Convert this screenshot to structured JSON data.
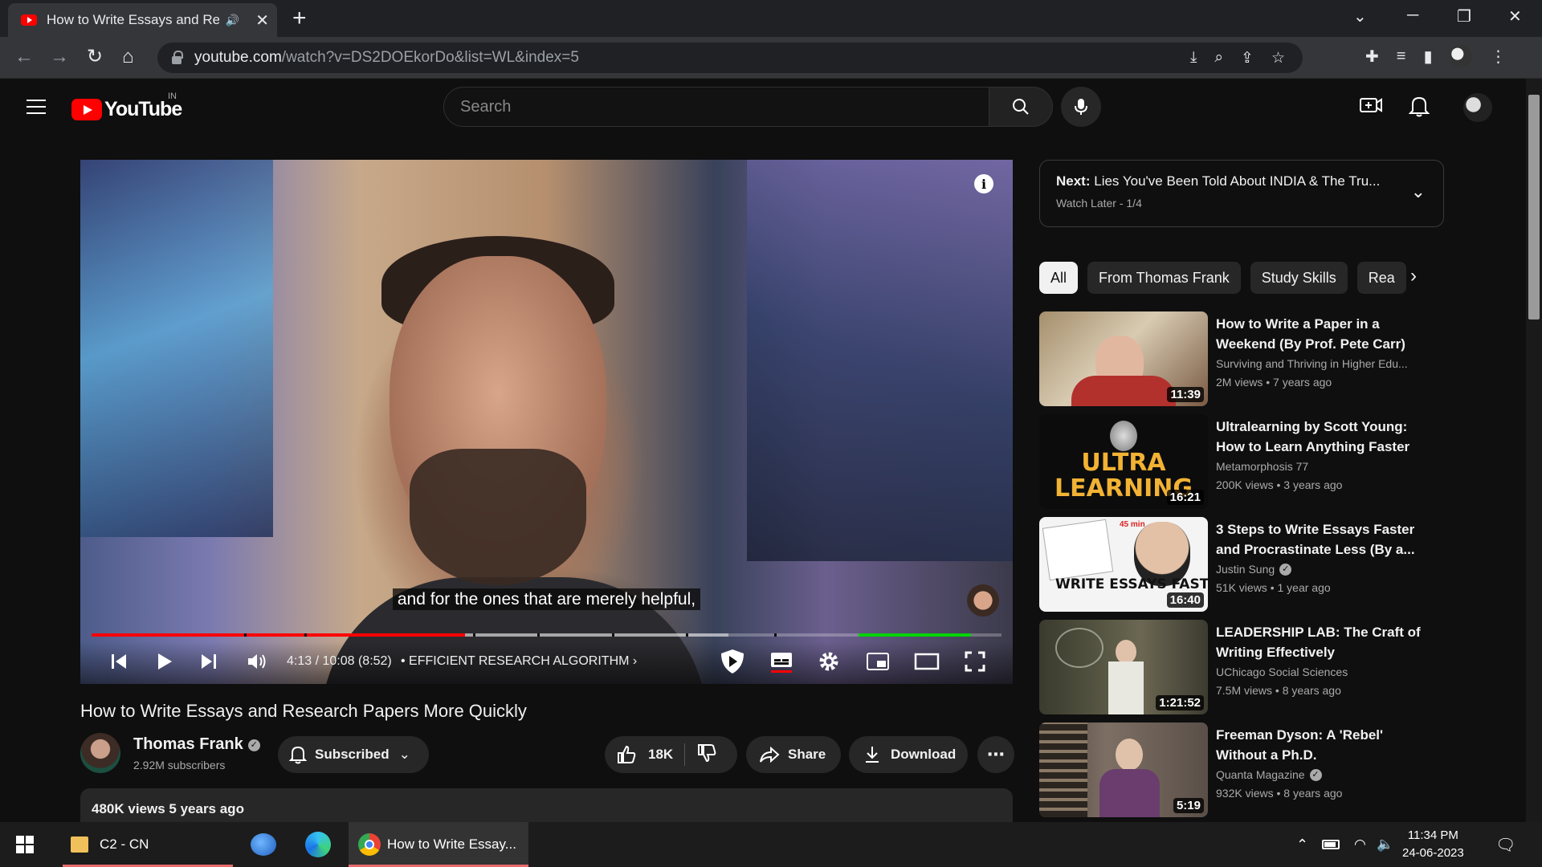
{
  "browser": {
    "tab_title": "How to Write Essays and Rese",
    "url_host": "youtube.com",
    "url_path": "/watch?v=DS2DOEkorDo&list=WL&index=5"
  },
  "masthead": {
    "logo_text": "YouTube",
    "country": "IN",
    "search_placeholder": "Search"
  },
  "player": {
    "caption": "and for the ones that are merely helpful,",
    "time": "4:13 / 10:08 (8:52)",
    "chapter": "• EFFICIENT RESEARCH ALGORITHM",
    "progress_played": 0.41,
    "progress_buffered": 0.7
  },
  "video": {
    "title": "How to Write Essays and Research Papers More Quickly",
    "channel": "Thomas Frank",
    "subscribers": "2.92M subscribers",
    "subscribe_label": "Subscribed",
    "likes": "18K",
    "share_label": "Share",
    "download_label": "Download",
    "views_date": "480K views  5 years ago"
  },
  "playlist": {
    "next_label": "Next:",
    "next_title": "Lies You've Been Told About INDIA & The Tru...",
    "next_sub": "Watch Later - 1/4"
  },
  "chips": [
    "All",
    "From Thomas Frank",
    "Study Skills",
    "Rea"
  ],
  "recommendations": [
    {
      "title": "How to Write a Paper in a Weekend (By Prof. Pete Carr)",
      "channel": "Surviving and Thriving in Higher Edu...",
      "meta": "2M views  • 7 years ago",
      "duration": "11:39",
      "verified": false
    },
    {
      "title": "Ultralearning by Scott Young: How to Learn Anything Faster",
      "channel": "Metamorphosis 77",
      "meta": "200K views  • 3 years ago",
      "duration": "16:21",
      "verified": false,
      "thumb_text": "ULTRA LEARNING"
    },
    {
      "title": "3 Steps to Write Essays Faster and Procrastinate Less (By a...",
      "channel": "Justin Sung",
      "meta": "51K views  • 1 year ago",
      "duration": "16:40",
      "verified": true,
      "thumb_text": "WRITE ESSAYS FAST",
      "thumb_badge": "45 min"
    },
    {
      "title": "LEADERSHIP LAB: The Craft of Writing Effectively",
      "channel": "UChicago Social Sciences",
      "meta": "7.5M views  • 8 years ago",
      "duration": "1:21:52",
      "verified": false
    },
    {
      "title": "Freeman Dyson: A 'Rebel' Without a Ph.D.",
      "channel": "Quanta Magazine",
      "meta": "932K views  • 8 years ago",
      "duration": "5:19",
      "verified": true
    }
  ],
  "taskbar": {
    "folder_label": "C2 - CN",
    "chrome_label": "How to Write Essay...",
    "time": "11:34 PM",
    "date": "24-06-2023"
  },
  "colors": {
    "accent": "#ff0000",
    "background": "#0f0f0f",
    "chip_active": "#f1f1f1",
    "sponsor_segment": "#00d400"
  }
}
